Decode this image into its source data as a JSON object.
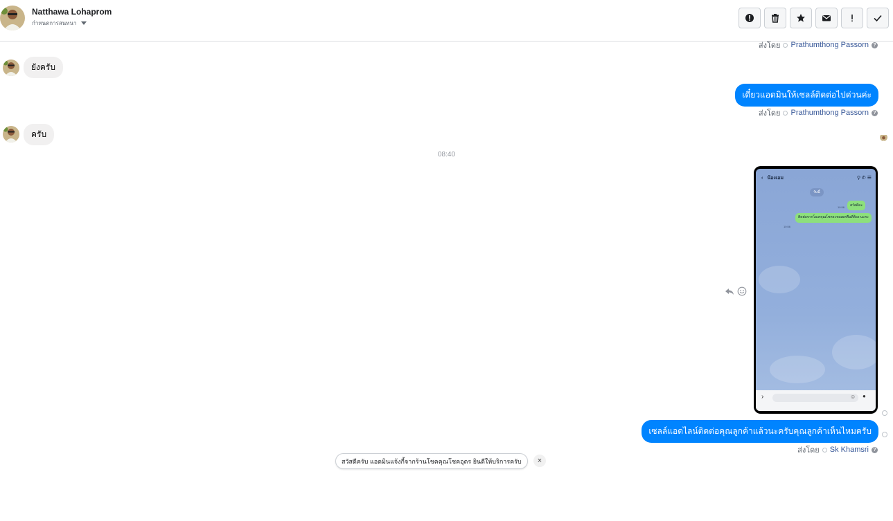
{
  "header": {
    "contact_name": "Natthawa Lohaprom",
    "subtitle": "กำหนดการสนทนา",
    "toolbar": [
      {
        "icon": "spam-icon",
        "label": "!"
      },
      {
        "icon": "trash-icon",
        "label": ""
      },
      {
        "icon": "star-icon",
        "label": ""
      },
      {
        "icon": "mail-icon",
        "label": ""
      },
      {
        "icon": "exclamation-icon",
        "label": "!"
      },
      {
        "icon": "check-icon",
        "label": ""
      }
    ]
  },
  "messages": {
    "sent_by_top": {
      "prefix": "ส่งโดย",
      "name": "Prathumthong Passorn"
    },
    "incoming_1": "ยังครับ",
    "outgoing_1": "เดี๋ยวแอดมินให้เซลล์ติดต่อไปด่วนค่ะ",
    "sent_by_1": {
      "prefix": "ส่งโดย",
      "name": "Prathumthong Passorn"
    },
    "incoming_2": "ครับ",
    "timestamp": "08:40",
    "outgoing_2": "เซลล์แอดไลน์ติดต่อคุณลูกค้าแล้วนะครับคุณลูกค้าเห็นไหมครับ",
    "sent_by_2": {
      "prefix": "ส่งโดย",
      "name": "Sk Khamsri"
    }
  },
  "phone_screenshot": {
    "chat_title": "น้องเอม",
    "date_chip": "วันนี้",
    "msg_1": "สวัสดีคะ",
    "msg_2": "ติดต่อจากโอเคคุณโชคจะขอเยคพืนที่ต้อง นะคะ",
    "time_1": "10:56",
    "time_2": "10:56"
  },
  "quick_reply": {
    "text": "สวัสดีครับ แอดมินแจ้งกี้จากร้านโชคคุณโชคอุดร ยินดีให้บริการครับ",
    "close": "×"
  },
  "colors": {
    "outgoing_bubble": "#0084ff",
    "incoming_bubble": "#f1f0f0",
    "link_name": "#385898"
  }
}
